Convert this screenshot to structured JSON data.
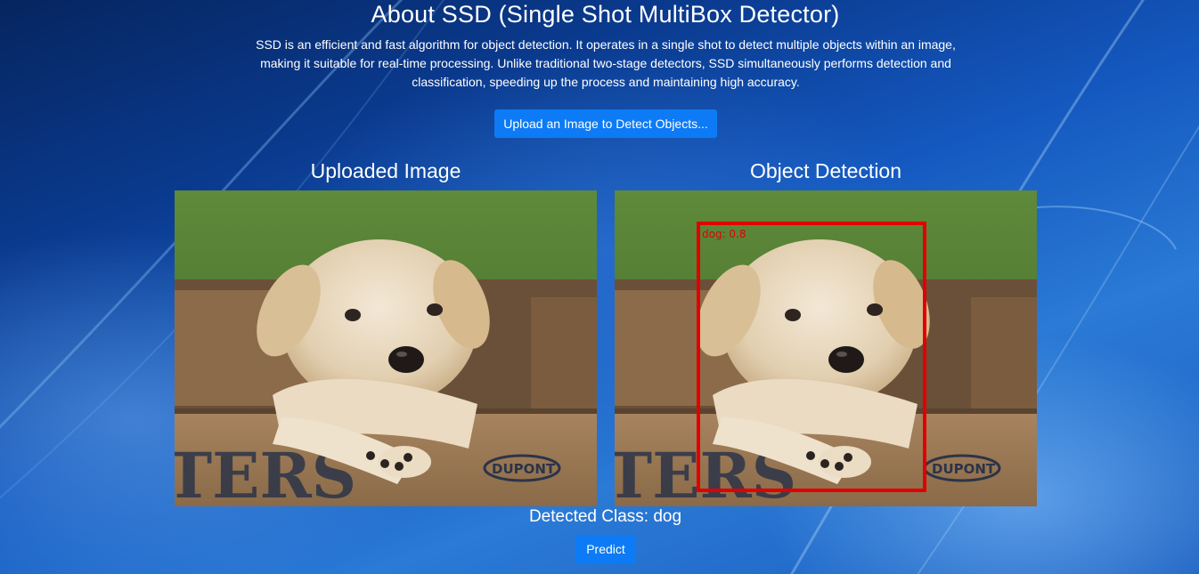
{
  "about": {
    "title": "About SSD (Single Shot MultiBox Detector)",
    "description": "SSD is an efficient and fast algorithm for object detection. It operates in a single shot to detect multiple objects within an image, making it suitable for real-time processing. Unlike traditional two-stage detectors, SSD simultaneously performs detection and classification, speeding up the process and maintaining high accuracy."
  },
  "upload": {
    "label": "Upload an Image to Detect Objects..."
  },
  "panels": {
    "uploaded_title": "Uploaded Image",
    "detection_title": "Object Detection"
  },
  "detection": {
    "box_label": "dog: 0.8",
    "box_color": "#e00000"
  },
  "result": {
    "detected_class": "Detected Class: dog"
  },
  "predict": {
    "label": "Predict"
  },
  "colors": {
    "button": "#0d7bf5",
    "background_dark": "#06255f",
    "background_light": "#2a7ad6"
  }
}
